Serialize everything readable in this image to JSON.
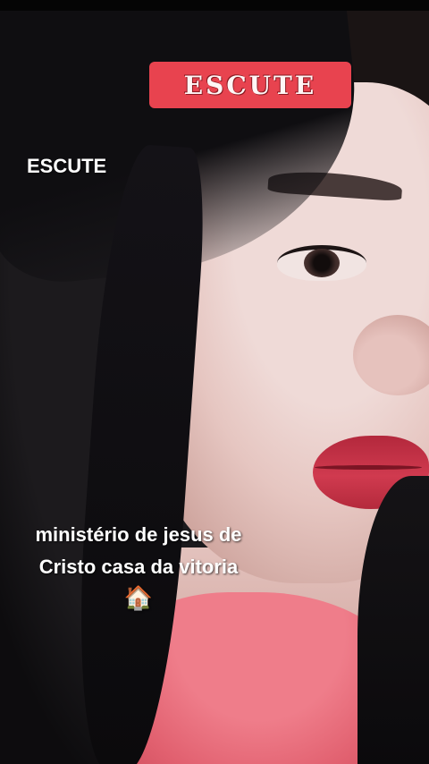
{
  "video": {
    "badge_title": "ESCUTE",
    "overlay_text": "ESCUTE",
    "caption_line1": "ministério de jesus de",
    "caption_line2": "Cristo casa da vitoria",
    "caption_emoji": "🏠",
    "badge_color": "#e8434f"
  }
}
